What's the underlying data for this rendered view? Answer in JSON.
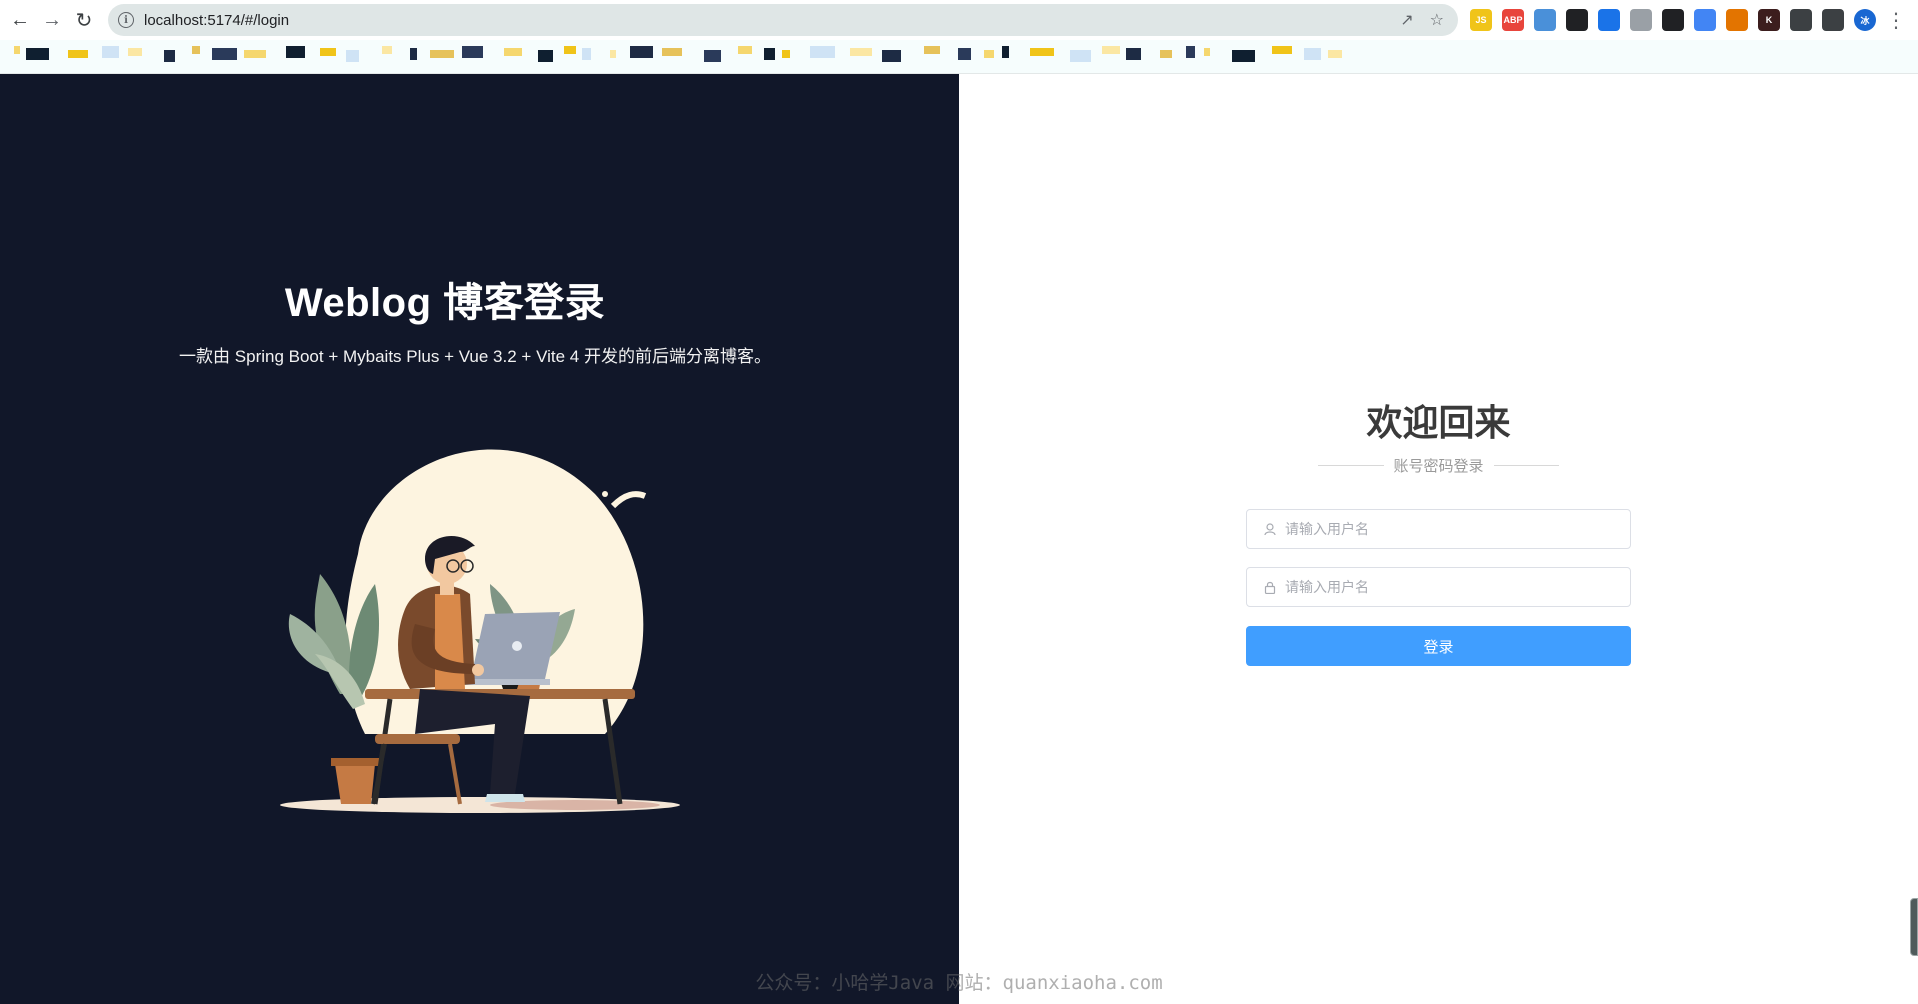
{
  "browser": {
    "url": "localhost:5174/#/login",
    "extensions": [
      {
        "name": "js-extension-icon",
        "label": "JS",
        "color": "#f0c419"
      },
      {
        "name": "adblock-icon",
        "label": "ABP",
        "color": "#e8453c"
      },
      {
        "name": "eyedropper-icon",
        "label": "",
        "color": "#4a90d9"
      },
      {
        "name": "extension-icon-4",
        "label": "",
        "color": "#202124"
      },
      {
        "name": "download-extension-icon",
        "label": "",
        "color": "#1a73e8"
      },
      {
        "name": "mail-extension-icon",
        "label": "",
        "color": "#9aa0a6"
      },
      {
        "name": "extension-icon-7",
        "label": "",
        "color": "#202124"
      },
      {
        "name": "translate-icon",
        "label": "",
        "color": "#4285f4"
      },
      {
        "name": "extension-icon-9",
        "label": "",
        "color": "#e37400"
      },
      {
        "name": "extension-icon-10",
        "label": "K",
        "color": "#3c1d1d"
      },
      {
        "name": "puzzle-icon",
        "label": "",
        "color": "#3c4043"
      },
      {
        "name": "side-panel-icon",
        "label": "",
        "color": "#3c4043"
      },
      {
        "name": "profile-avatar",
        "label": "冰",
        "color": "#1967d2"
      }
    ]
  },
  "left": {
    "title": "Weblog 博客登录",
    "subtitle": "一款由 Spring Boot + Mybaits Plus + Vue 3.2 + Vite 4 开发的前后端分离博客。"
  },
  "login": {
    "welcome": "欢迎回来",
    "divider_text": "账号密码登录",
    "username_placeholder": "请输入用户名",
    "password_placeholder": "请输入用户名",
    "submit_label": "登录"
  },
  "watermark": "公众号：小哈学Java 网站：quanxiaoha.com",
  "colors": {
    "left_bg": "#111729",
    "primary": "#409eff"
  }
}
